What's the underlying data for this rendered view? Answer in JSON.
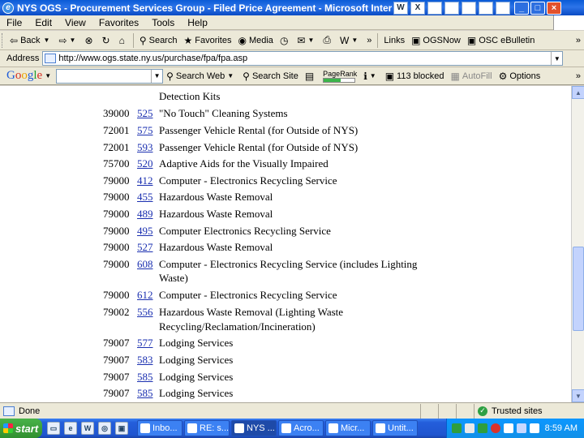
{
  "window": {
    "title": "NYS OGS - Procurement Services Group - Filed Price Agreement - Microsoft Internet Exp",
    "controls": {
      "minimize": "_",
      "maximize": "□",
      "close": "×"
    },
    "title_tray": [
      "W",
      "X",
      "",
      "",
      "",
      "",
      "",
      ""
    ]
  },
  "menu": [
    "File",
    "Edit",
    "View",
    "Favorites",
    "Tools",
    "Help"
  ],
  "toolbar": {
    "back": "Back",
    "search": "Search",
    "favorites": "Favorites",
    "media": "Media",
    "overflow": "»",
    "links_label": "Links",
    "link1": "OGSNow",
    "link2": "OSC eBulletin"
  },
  "address": {
    "label": "Address",
    "url": "http://www.ogs.state.ny.us/purchase/fpa/fpa.asp"
  },
  "google_bar": {
    "logo": [
      "G",
      "o",
      "o",
      "g",
      "l",
      "e"
    ],
    "search_web": "Search Web",
    "search_site": "Search Site",
    "pagerank": "PageRank",
    "blocked": "113 blocked",
    "autofill": "AutoFill",
    "options": "Options"
  },
  "content": {
    "rows": [
      {
        "code": "",
        "num": "",
        "desc": "Detection Kits"
      },
      {
        "code": "39000",
        "num": "525",
        "desc": "\"No Touch\" Cleaning Systems"
      },
      {
        "code": "72001",
        "num": "575",
        "desc": "Passenger Vehicle Rental (for Outside of NYS)"
      },
      {
        "code": "72001",
        "num": "593",
        "desc": "Passenger Vehicle Rental (for Outside of NYS)"
      },
      {
        "code": "75700",
        "num": "520",
        "desc": "Adaptive Aids for the Visually Impaired"
      },
      {
        "code": "79000",
        "num": "412",
        "desc": "Computer - Electronics Recycling Service"
      },
      {
        "code": "79000",
        "num": "455",
        "desc": "Hazardous Waste Removal"
      },
      {
        "code": "79000",
        "num": "489",
        "desc": "Hazardous Waste Removal"
      },
      {
        "code": "79000",
        "num": "495",
        "desc": "Computer Electronics Recycling Service"
      },
      {
        "code": "79000",
        "num": "527",
        "desc": "Hazardous Waste Removal"
      },
      {
        "code": "79000",
        "num": "608",
        "desc": "Computer - Electronics Recycling Service (includes Lighting",
        "desc2": "Waste)"
      },
      {
        "code": "79000",
        "num": "612",
        "desc": "Computer - Electronics Recycling Service"
      },
      {
        "code": "79002",
        "num": "556",
        "desc": "Hazardous Waste Removal (Lighting Waste",
        "desc2": "Recycling/Reclamation/Incineration)"
      },
      {
        "code": "79007",
        "num": "577",
        "desc": "Lodging Services"
      },
      {
        "code": "79007",
        "num": "583",
        "desc": "Lodging Services"
      },
      {
        "code": "79007",
        "num": "585",
        "desc": "Lodging Services"
      },
      {
        "code": "79007",
        "num": "585",
        "desc": "Lodging Services"
      }
    ]
  },
  "status": {
    "text": "Done",
    "zone": "Trusted sites"
  },
  "taskbar": {
    "start": "start",
    "tasks": [
      "Inbo...",
      "RE: s...",
      "NYS ...",
      "Acro...",
      "Micr...",
      "Untit..."
    ],
    "clock": "8:59 AM"
  }
}
